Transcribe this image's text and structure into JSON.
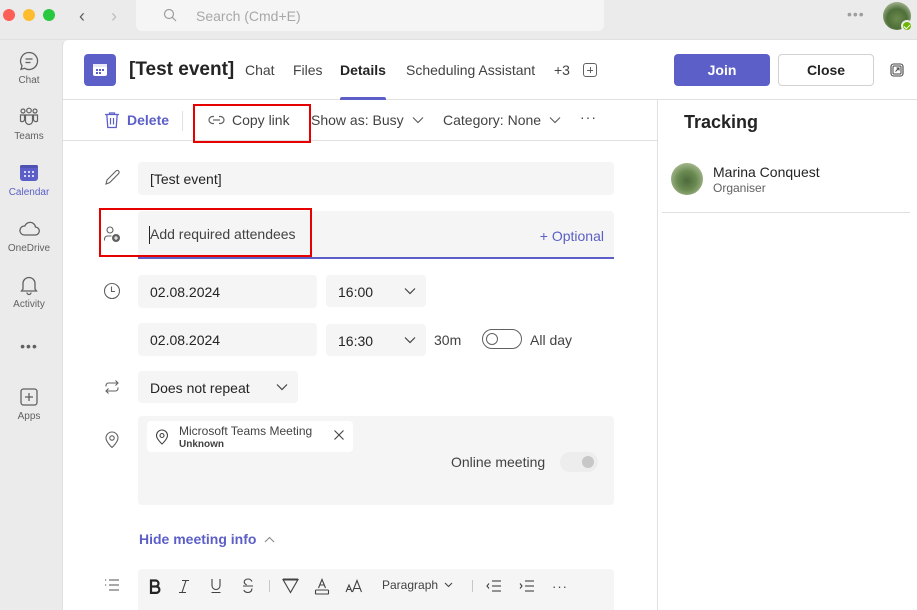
{
  "titlebar": {
    "search_placeholder": "Search (Cmd+E)",
    "more_label": "•••"
  },
  "rail": {
    "items": [
      {
        "label": "Chat",
        "icon": "chat-icon",
        "active": false
      },
      {
        "label": "Teams",
        "icon": "teams-icon",
        "active": false
      },
      {
        "label": "Calendar",
        "icon": "calendar-icon",
        "active": true
      },
      {
        "label": "OneDrive",
        "icon": "cloud-icon",
        "active": false
      },
      {
        "label": "Activity",
        "icon": "bell-icon",
        "active": false
      },
      {
        "label": "Apps",
        "icon": "add-app-icon",
        "active": false
      }
    ],
    "more_label": "•••"
  },
  "header": {
    "title": "[Test event]",
    "tabs": [
      {
        "label": "Chat",
        "active": false
      },
      {
        "label": "Files",
        "active": false
      },
      {
        "label": "Details",
        "active": true
      },
      {
        "label": "Scheduling Assistant",
        "active": false
      },
      {
        "label": "+3",
        "active": false
      }
    ],
    "join_label": "Join",
    "close_label": "Close"
  },
  "toolbar": {
    "delete_label": "Delete",
    "copy_link_label": "Copy link",
    "show_as_label": "Show as: Busy",
    "category_label": "Category: None",
    "more_label": "···"
  },
  "form": {
    "title_value": "[Test event]",
    "attendees_placeholder": "Add required attendees",
    "optional_label": "+ Optional",
    "start_date": "02.08.2024",
    "start_time": "16:00",
    "end_date": "02.08.2024",
    "end_time": "16:30",
    "duration": "30m",
    "all_day_label": "All day",
    "all_day_on": false,
    "repeat_value": "Does not repeat",
    "location": {
      "name": "Microsoft Teams Meeting",
      "subtitle": "Unknown"
    },
    "online_meeting_label": "Online meeting",
    "online_meeting_on": true,
    "hide_info_label": "Hide meeting info"
  },
  "editor": {
    "paragraph_label": "Paragraph",
    "more_label": "···"
  },
  "tracking": {
    "title": "Tracking",
    "organiser_name": "Marina Conquest",
    "organiser_role": "Organiser"
  },
  "colors": {
    "accent": "#5b5fc7",
    "highlight": "#e60000",
    "presence": "#6bb700"
  }
}
